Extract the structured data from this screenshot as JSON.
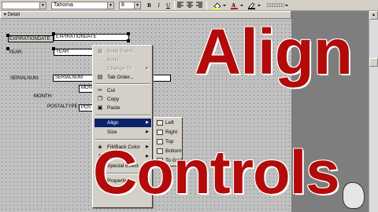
{
  "toolbar": {
    "font_name": "Tahoma",
    "font_size": "8",
    "bold": "B",
    "italic": "I",
    "underline": "U"
  },
  "section": {
    "name": "Detail"
  },
  "form": {
    "labels": {
      "expiration_label": "EXPIRATIONDATE:",
      "year_label": "YEAR:",
      "serialnum_label": "SERIALNUM:",
      "month_label": "MONTH:",
      "postaltype_label": "POSTALTYPE:"
    },
    "fields": {
      "expiration_field": "EXPIRATIONDATE",
      "year_field": "YEAR",
      "serialnum_field": "SERIALNUM",
      "month_field": "MONTH",
      "postal_field": "POSTA"
    }
  },
  "context_menu": {
    "items": [
      {
        "label": "Build Event...",
        "disabled": true
      },
      {
        "label": "Build...",
        "disabled": true
      },
      {
        "label": "Change To",
        "disabled": true
      },
      {
        "label": "Tab Order...",
        "disabled": false
      },
      {
        "label": "Cut",
        "disabled": false
      },
      {
        "label": "Copy",
        "disabled": false
      },
      {
        "label": "Paste",
        "disabled": false
      },
      {
        "label": "Align",
        "disabled": false,
        "highlighted": true
      },
      {
        "label": "Size",
        "disabled": false
      },
      {
        "label": "Fill/Back Color",
        "disabled": false
      },
      {
        "label": "Fore Color",
        "disabled": false
      },
      {
        "label": "Special Effect",
        "disabled": false
      },
      {
        "label": "Properties",
        "disabled": false
      }
    ]
  },
  "align_submenu": {
    "items": [
      "Left",
      "Right",
      "Top",
      "Bottom",
      "To Grid"
    ]
  },
  "overlay": {
    "title1": "Align",
    "title2": "Controls"
  },
  "colors": {
    "highlight": "#0a246a",
    "overlay_text": "#b30a0a",
    "grid_bg": "#c0c0c0"
  }
}
